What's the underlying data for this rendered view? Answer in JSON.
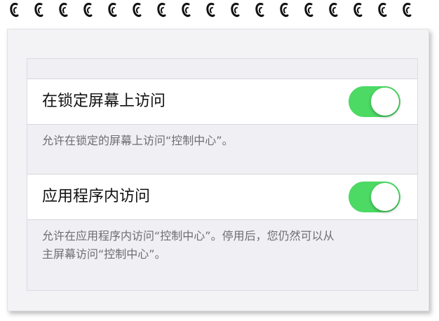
{
  "icons": {
    "spiral": "notebook-ring-icon"
  },
  "colors": {
    "toggle_on": "#4cd964",
    "background": "#efeff4",
    "footer_text": "#6d6d72"
  },
  "settings": {
    "lock_screen": {
      "label": "在锁定屏幕上访问",
      "enabled": true,
      "footer": "允许在锁定的屏幕上访问“控制中心”。"
    },
    "in_apps": {
      "label": "应用程序内访问",
      "enabled": true,
      "footer_line1": "允许在应用程序内访问“控制中心”。停用后，您仍然可以从",
      "footer_line2": "主屏幕访问“控制中心”。"
    }
  }
}
